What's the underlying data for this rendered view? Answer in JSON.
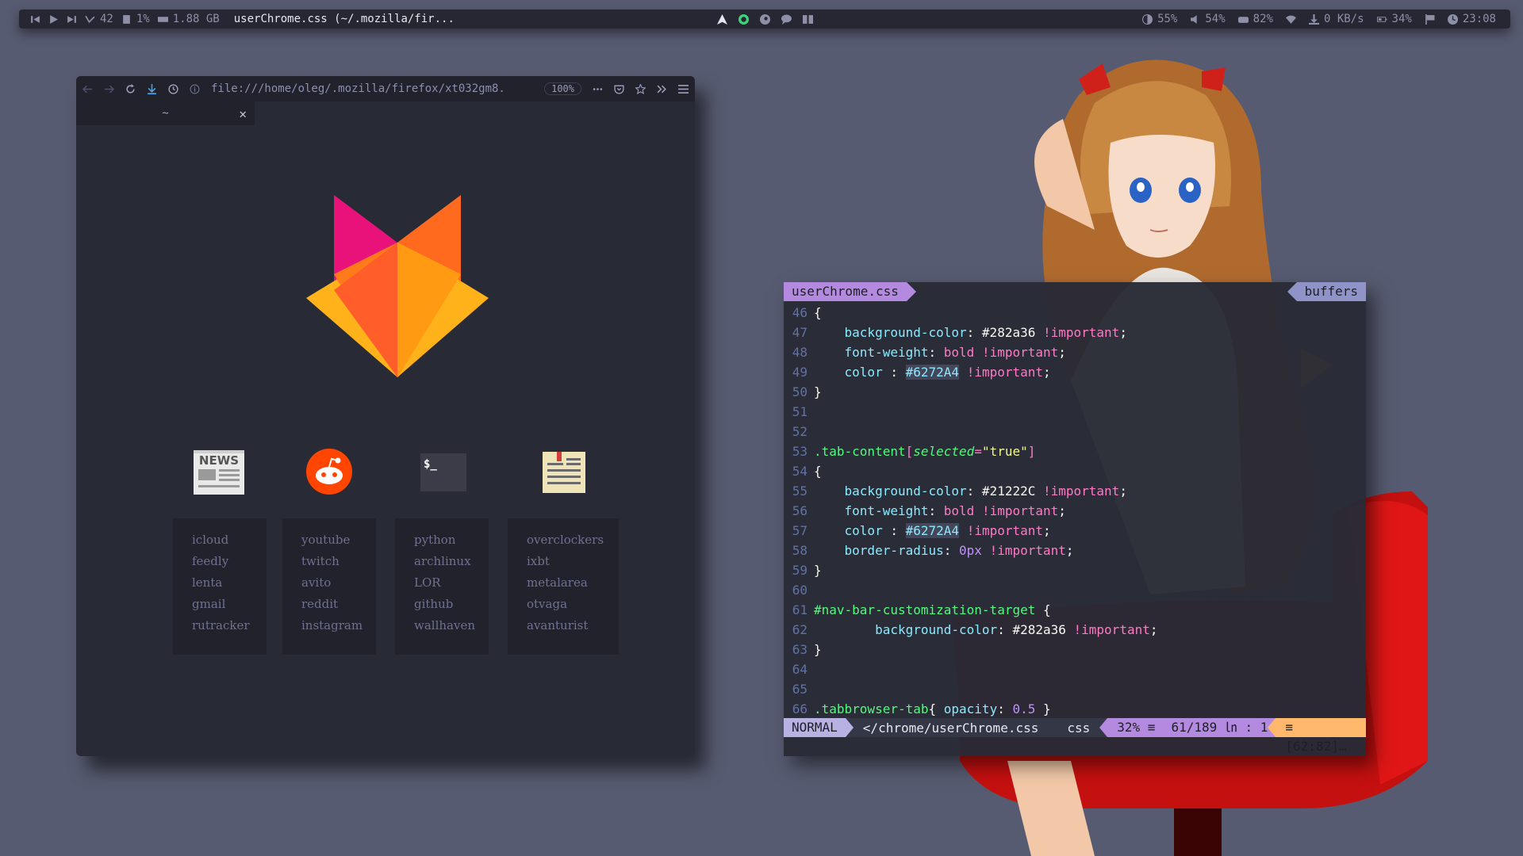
{
  "topbar": {
    "updates": "42",
    "cpu": "1%",
    "memory": "1.88 GB",
    "window_title": "userChrome.css (~/.mozilla/fir...",
    "brightness": "55%",
    "volume": "54%",
    "disk": "82%",
    "net_speed": "0 KB/s",
    "battery": "34%",
    "clock": "23:08"
  },
  "firefox": {
    "url": "file:///home/oleg/.mozilla/firefox/xt032gm8.",
    "zoom": "100%",
    "tab_title": "~",
    "tiles": [
      {
        "icon": "news-icon",
        "links": [
          "icloud",
          "feedly",
          "lenta",
          "gmail",
          "rutracker"
        ]
      },
      {
        "icon": "reddit-icon",
        "links": [
          "youtube",
          "twitch",
          "avito",
          "reddit",
          "instagram"
        ]
      },
      {
        "icon": "terminal-icon",
        "links": [
          "python",
          "archlinux",
          "LOR",
          "github",
          "wallhaven"
        ]
      },
      {
        "icon": "notes-icon",
        "links": [
          "overclockers",
          "ixbt",
          "metalarea",
          "otvaga",
          "avanturist"
        ]
      }
    ],
    "news_label": "NEWS",
    "terminal_label": "$_"
  },
  "vim": {
    "buffer_tab": "userChrome.css",
    "buffers_label": "buffers",
    "status": {
      "mode": "NORMAL",
      "file": "</chrome/userChrome.css",
      "filetype": "css",
      "percent": "32% ≡",
      "position": "61/189 ㏑ :  1",
      "warning": "≡ [62:82]…"
    }
  }
}
